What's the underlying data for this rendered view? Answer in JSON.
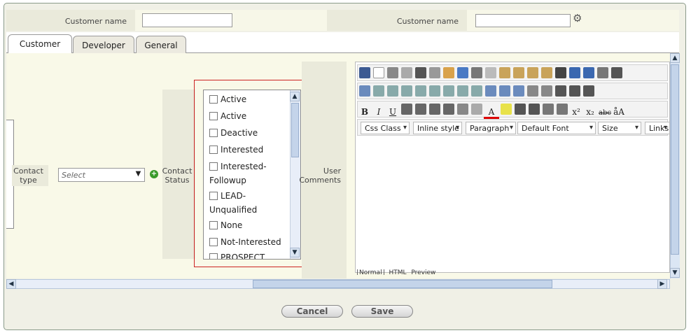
{
  "header": {
    "customer_name_label_1": "Customer name",
    "customer_name_value_1": "",
    "customer_name_label_2": "Customer name",
    "customer_name_value_2": ""
  },
  "tabs": [
    "Customer",
    "Developer",
    "General"
  ],
  "form": {
    "contact_type_label": "Contact type",
    "contact_type_select": "Select",
    "contact_status_label": "Contact Status",
    "user_comments_label": "User Comments"
  },
  "status_options": [
    "Active",
    "Active",
    "Deactive",
    "Interested",
    "Interested-Followup",
    "LEAD-Unqualified",
    "None",
    "Not-Interested",
    "PROSPECT"
  ],
  "editor": {
    "css_class": "Css Class",
    "inline_style": "Inline style",
    "paragraph": "Paragraph",
    "font": "Default Font",
    "size": "Size",
    "links": "Links",
    "mode_normal": "Normal",
    "mode_html": "HTML",
    "mode_preview": "Preview"
  },
  "footer": {
    "cancel_label": "Cancel",
    "save_label": "Save"
  },
  "colors": {
    "highlight_border": "#cc2222",
    "scroll_blue": "#dbe6f4"
  }
}
